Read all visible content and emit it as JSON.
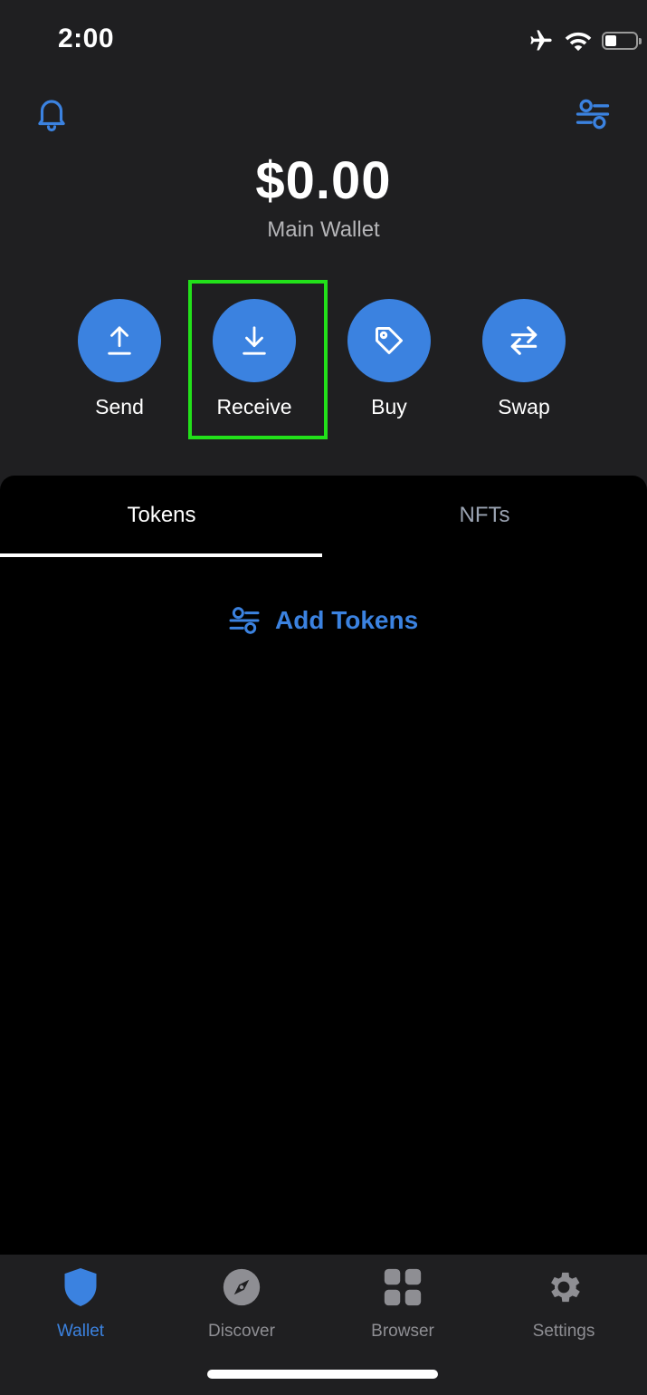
{
  "status": {
    "time": "2:00"
  },
  "wallet": {
    "balance": "$0.00",
    "name": "Main Wallet"
  },
  "actions": [
    {
      "label": "Send",
      "icon": "arrow-up-icon"
    },
    {
      "label": "Receive",
      "icon": "arrow-down-icon"
    },
    {
      "label": "Buy",
      "icon": "tag-icon"
    },
    {
      "label": "Swap",
      "icon": "swap-arrows-icon"
    }
  ],
  "tabs": {
    "tokens": "Tokens",
    "nfts": "NFTs",
    "active": "Tokens"
  },
  "add_tokens_label": "Add Tokens",
  "tabbar": {
    "items": [
      {
        "label": "Wallet",
        "icon": "shield-icon",
        "active": true
      },
      {
        "label": "Discover",
        "icon": "compass-icon",
        "active": false
      },
      {
        "label": "Browser",
        "icon": "grid-icon",
        "active": false
      },
      {
        "label": "Settings",
        "icon": "gear-icon",
        "active": false
      }
    ]
  },
  "colors": {
    "accent": "#3b82e0",
    "header_bg": "#1f1f21",
    "panel_bg": "#000000",
    "highlight": "#22e01a",
    "inactive": "#8e8e93"
  }
}
